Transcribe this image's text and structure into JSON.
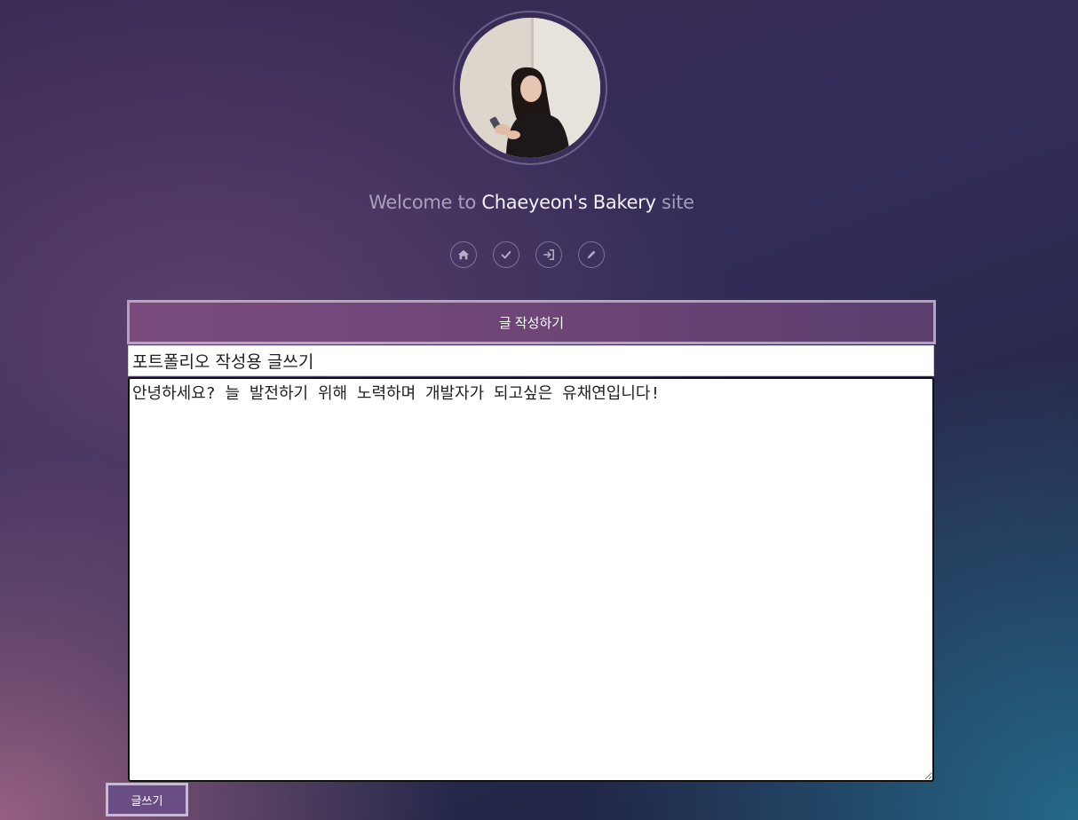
{
  "profile": {
    "avatar_alt": "profile photo"
  },
  "welcome": {
    "prefix": "Welcome to",
    "brand": "Chaeyeon's Bakery",
    "suffix": "site"
  },
  "nav": {
    "icons": [
      "home-icon",
      "check-icon",
      "sign-in-icon",
      "pencil-icon"
    ]
  },
  "form": {
    "header": "글 작성하기",
    "title_value": "포트폴리오 작성용 글쓰기",
    "body_value": "안녕하세요? 늘 발전하기 위해 노력하며 개발자가 되고싶은 유채연입니다!",
    "submit_label": "글쓰기"
  },
  "colors": {
    "header_bg": "#7a4a7c",
    "button_bg": "#6a4d84",
    "brand_text": "#f3f0fa"
  }
}
